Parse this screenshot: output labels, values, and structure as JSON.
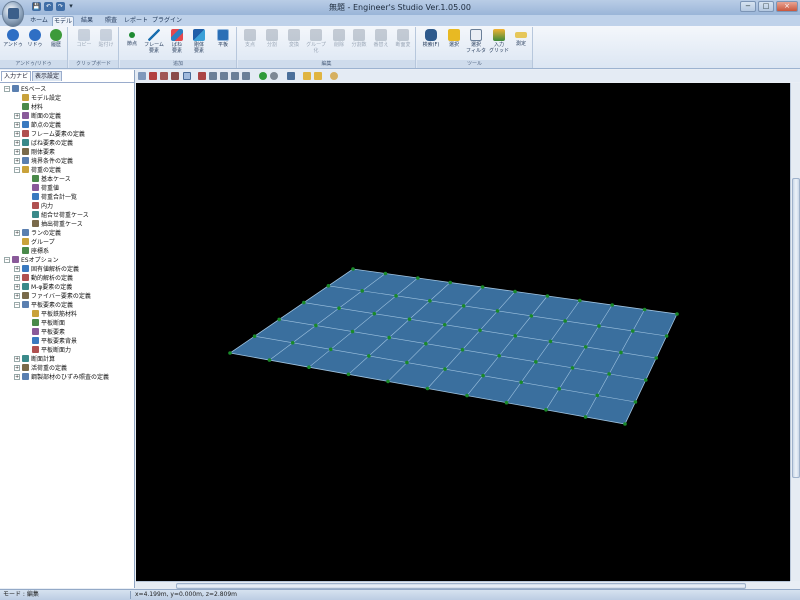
{
  "window": {
    "title": "無題 - Engineer's Studio Ver.1.05.00",
    "controls": [
      "−",
      "□",
      "×"
    ]
  },
  "qat": {
    "items": [
      "💾",
      "↶",
      "↷"
    ],
    "overflow": "▾"
  },
  "ribbon": {
    "tabs": [
      {
        "label": "ホーム",
        "active": false
      },
      {
        "label": "モデル",
        "active": true
      },
      {
        "label": "結果",
        "active": false
      },
      {
        "label": "照査",
        "active": false
      },
      {
        "label": "レポート",
        "active": false
      },
      {
        "label": "プラグイン",
        "active": false
      }
    ],
    "groups": [
      {
        "label": "アンドゥ/リドゥ",
        "buttons": [
          {
            "label": "アンドゥ",
            "icon": "undo-icon",
            "enabled": true
          },
          {
            "label": "リドゥ",
            "icon": "redo-icon",
            "enabled": true
          },
          {
            "label": "履歴",
            "icon": "history-icon",
            "enabled": true
          }
        ]
      },
      {
        "label": "クリップボード",
        "buttons": [
          {
            "label": "コピー",
            "icon": "copy-icon",
            "enabled": false
          },
          {
            "label": "貼付け",
            "icon": "paste-icon",
            "enabled": false
          }
        ]
      },
      {
        "label": "追加",
        "buttons": [
          {
            "label": "節点",
            "icon": "node-icon",
            "enabled": true
          },
          {
            "label": "フレーム\n要素",
            "icon": "frame-element-icon",
            "enabled": true
          },
          {
            "label": "ばね\n要素",
            "icon": "spring-element-icon",
            "enabled": true
          },
          {
            "label": "剛体\n要素",
            "icon": "rigid-element-icon",
            "enabled": true
          },
          {
            "label": "平板",
            "icon": "plate-icon",
            "enabled": true
          }
        ]
      },
      {
        "label": "編集",
        "buttons": [
          {
            "label": "支点",
            "icon": "support-icon",
            "enabled": false
          },
          {
            "label": "分割",
            "icon": "split-icon",
            "enabled": false
          },
          {
            "label": "変換",
            "icon": "convert-icon",
            "enabled": false
          },
          {
            "label": "グループ\n化",
            "icon": "group-icon",
            "enabled": false
          },
          {
            "label": "削除",
            "icon": "delete-icon",
            "enabled": false
          },
          {
            "label": "分割数",
            "icon": "divisions-icon",
            "enabled": false
          },
          {
            "label": "番替え",
            "icon": "renumber-icon",
            "enabled": false
          },
          {
            "label": "断面変",
            "icon": "section-change-icon",
            "enabled": false
          }
        ]
      },
      {
        "label": "ツール",
        "buttons": [
          {
            "label": "検索(F)",
            "icon": "find-icon",
            "enabled": true
          },
          {
            "label": "選択",
            "icon": "select-icon",
            "enabled": true
          },
          {
            "label": "選択\nフィルタ",
            "icon": "select-filter-icon",
            "enabled": true
          },
          {
            "label": "入力\nグリッド",
            "icon": "input-grid-icon",
            "enabled": true
          },
          {
            "label": "測定",
            "icon": "measure-icon",
            "enabled": true
          }
        ]
      }
    ]
  },
  "left_panel": {
    "tabs": [
      {
        "label": "入力ナビ",
        "active": true
      },
      {
        "label": "表示設定",
        "active": false
      }
    ],
    "tree": [
      {
        "label": "ESベース",
        "depth": 0,
        "expander": "−",
        "icon": "folder-icon"
      },
      {
        "label": "モデル設定",
        "depth": 1,
        "expander": "",
        "icon": "settings-icon"
      },
      {
        "label": "材料",
        "depth": 1,
        "expander": "",
        "icon": "material-icon"
      },
      {
        "label": "断面の定義",
        "depth": 1,
        "expander": "+",
        "icon": "section-icon"
      },
      {
        "label": "節点の定義",
        "depth": 1,
        "expander": "+",
        "icon": "node-icon"
      },
      {
        "label": "フレーム要素の定義",
        "depth": 1,
        "expander": "+",
        "icon": "frame-element-icon"
      },
      {
        "label": "ばね要素の定義",
        "depth": 1,
        "expander": "+",
        "icon": "spring-element-icon"
      },
      {
        "label": "剛体要素",
        "depth": 1,
        "expander": "+",
        "icon": "rigid-element-icon"
      },
      {
        "label": "境界条件の定義",
        "depth": 1,
        "expander": "+",
        "icon": "boundary-icon"
      },
      {
        "label": "荷重の定義",
        "depth": 1,
        "expander": "−",
        "icon": "load-icon"
      },
      {
        "label": "基本ケース",
        "depth": 2,
        "expander": "",
        "icon": "load-case-icon"
      },
      {
        "label": "荷重値",
        "depth": 2,
        "expander": "",
        "icon": "load-value-icon"
      },
      {
        "label": "荷重合計一覧",
        "depth": 2,
        "expander": "",
        "icon": "load-total-icon"
      },
      {
        "label": "内力",
        "depth": 2,
        "expander": "",
        "icon": "internal-force-icon"
      },
      {
        "label": "組合せ荷重ケース",
        "depth": 2,
        "expander": "",
        "icon": "combination-icon"
      },
      {
        "label": "抽出荷重ケース",
        "depth": 2,
        "expander": "",
        "icon": "extract-icon"
      },
      {
        "label": "ランの定義",
        "depth": 1,
        "expander": "+",
        "icon": "run-icon"
      },
      {
        "label": "グループ",
        "depth": 1,
        "expander": "",
        "icon": "group-icon"
      },
      {
        "label": "座標系",
        "depth": 1,
        "expander": "",
        "icon": "axis-icon"
      },
      {
        "label": "ESオプション",
        "depth": 0,
        "expander": "−",
        "icon": "folder-icon"
      },
      {
        "label": "固有値解析の定義",
        "depth": 1,
        "expander": "+",
        "icon": "eigen-icon"
      },
      {
        "label": "動的解析の定義",
        "depth": 1,
        "expander": "+",
        "icon": "dynamic-icon"
      },
      {
        "label": "M-φ要素の定義",
        "depth": 1,
        "expander": "+",
        "icon": "m-phi-icon"
      },
      {
        "label": "ファイバー要素の定義",
        "depth": 1,
        "expander": "+",
        "icon": "fiber-icon"
      },
      {
        "label": "平板要素の定義",
        "depth": 1,
        "expander": "−",
        "icon": "plate-icon"
      },
      {
        "label": "平板鉄筋材料",
        "depth": 2,
        "expander": "",
        "icon": "rebar-material-icon"
      },
      {
        "label": "平板断面",
        "depth": 2,
        "expander": "",
        "icon": "plate-section-icon"
      },
      {
        "label": "平板要素",
        "depth": 2,
        "expander": "",
        "icon": "plate-element-icon"
      },
      {
        "label": "平板要素背景",
        "depth": 2,
        "expander": "",
        "icon": "plate-background-icon"
      },
      {
        "label": "平板断面力",
        "depth": 2,
        "expander": "",
        "icon": "plate-force-icon"
      },
      {
        "label": "断面計算",
        "depth": 1,
        "expander": "+",
        "icon": "section-calc-icon"
      },
      {
        "label": "活荷重の定義",
        "depth": 1,
        "expander": "+",
        "icon": "live-load-icon"
      },
      {
        "label": "鋼製部材のひずみ照査の定義",
        "depth": 1,
        "expander": "+",
        "icon": "steel-strain-icon"
      }
    ]
  },
  "toolbar": {
    "icons": [
      "view-select-icon",
      "box-icon",
      "box-front-icon",
      "box-side-icon",
      "rotate-view-icon",
      "zoom-window-icon",
      "zoom-in-icon",
      "zoom-out-icon",
      "pan-icon",
      "fit-icon",
      "play-icon",
      "stop-icon",
      "export-icon",
      "folder-open-icon",
      "folder-save-icon",
      "search-view-icon"
    ]
  },
  "viewport": {
    "background": "#000000",
    "mesh": {
      "plate_color": "#3a6f9e",
      "grid_line_color": "#9fc3e0",
      "node_color": "#1a8a2a",
      "columns": 10,
      "rows": 5
    }
  },
  "status": {
    "mode": "モード : 編集",
    "coordinates": "x=4.199m, y=0.000m, z=2.809m"
  },
  "colors": {
    "titlebar": "#a9c2e0",
    "ribbon_active_tab": "#eef3fa",
    "panel_border": "#8fa5c2"
  }
}
